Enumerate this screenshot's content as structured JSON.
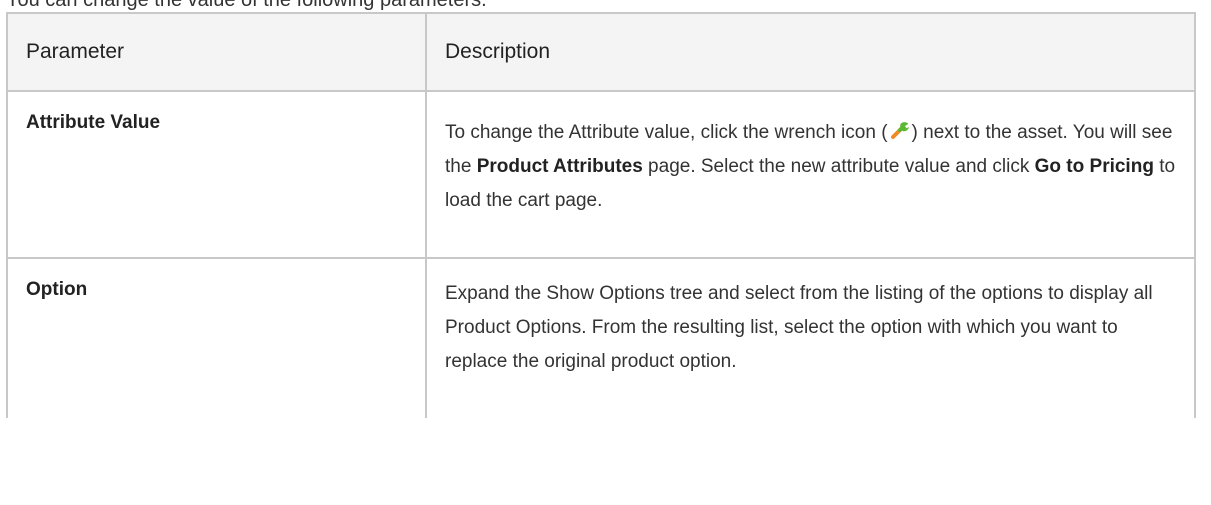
{
  "intro_text": "You can change the value of the following parameters.",
  "table": {
    "headers": [
      "Parameter",
      "Description"
    ],
    "rows": [
      {
        "parameter": "Attribute Value",
        "description": {
          "t1": "To change the Attribute value, click the wrench icon (",
          "icon": "wrench-icon",
          "t2": ") next to the asset. You will see the ",
          "b1": "Product Attributes",
          "t3": " page. Select the new attribute value and click ",
          "b2": "Go to Pricing",
          "t4": " to load the cart page."
        }
      },
      {
        "parameter": "Option",
        "description": "Expand the Show Options tree and select from the listing of the options to display all Product Options. From the resulting list, select the option with which you want to replace the original product option."
      }
    ]
  },
  "colors": {
    "border": "#c8c8c8",
    "header_bg": "#f4f4f4",
    "wrench_green": "#5cb832",
    "wrench_orange": "#f08a24"
  }
}
